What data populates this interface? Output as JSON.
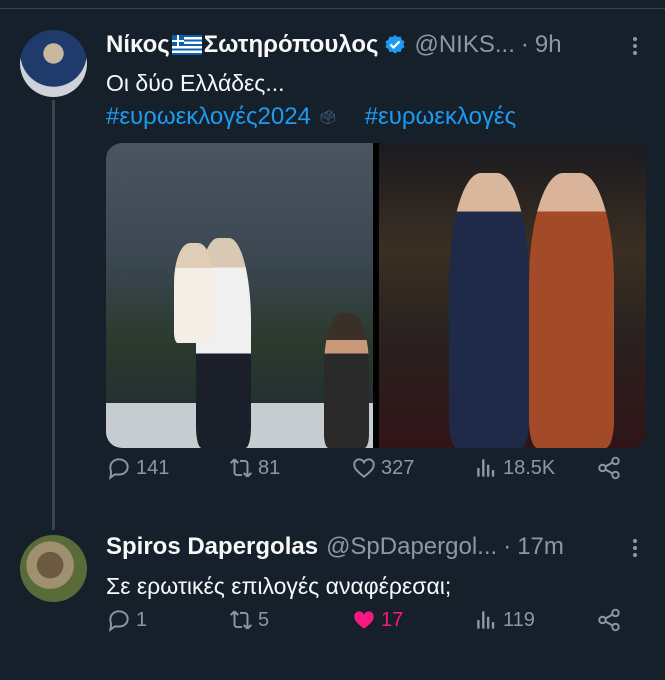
{
  "colors": {
    "background": "#15202b",
    "accent": "#1d9bf0",
    "muted": "#8b98a5",
    "like": "#f91880"
  },
  "tweet1": {
    "author_name": "Νίκος",
    "author_name_after_flag": "Σωτηρόπουλος",
    "handle": "@NIKS...",
    "separator": "·",
    "time": "9h",
    "text": "Οι δύο Ελλάδες...",
    "hashtags": [
      "#ευρωεκλογές2024",
      "#ευρωεκλογές"
    ],
    "ballot_icon": "ballot-box-icon",
    "replies": "141",
    "retweets": "81",
    "likes": "327",
    "views": "18.5K"
  },
  "tweet2": {
    "author_name": "Spiros Dapergolas",
    "handle": "@SpDapergol...",
    "separator": "·",
    "time": "17m",
    "text": "Σε ερωτικές επιλογές αναφέρεσαι;",
    "replies": "1",
    "retweets": "5",
    "likes": "17",
    "views": "119",
    "liked": true
  }
}
